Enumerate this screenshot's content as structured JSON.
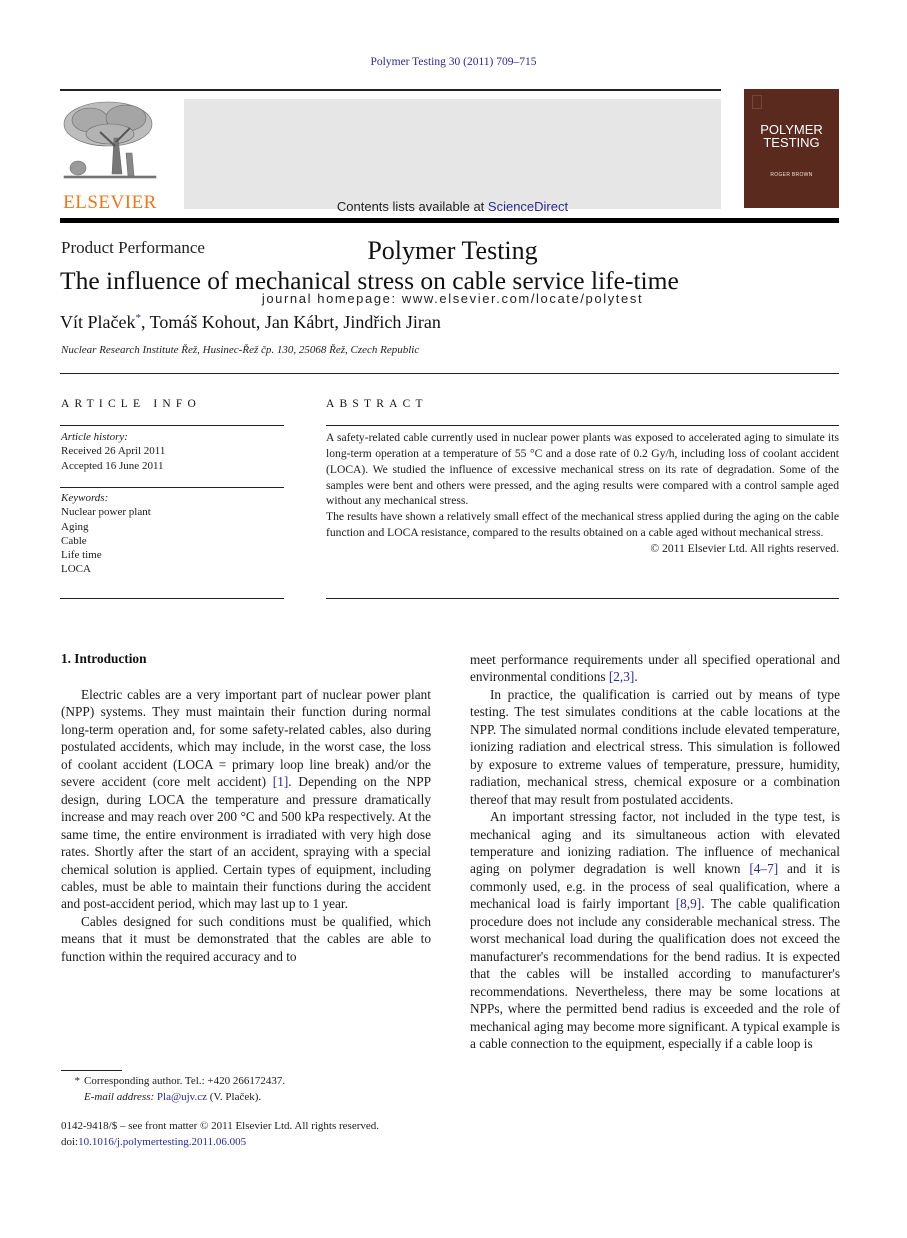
{
  "citation": "Polymer Testing 30 (2011) 709–715",
  "header": {
    "publisher_logo_text": "ELSEVIER",
    "contents_prefix": "Contents lists available at ",
    "contents_link": "ScienceDirect",
    "journal_title": "Polymer Testing",
    "homepage_line": "journal homepage: www.elsevier.com/locate/polytest",
    "cover": {
      "title_line1": "POLYMER",
      "title_line2": "TESTING",
      "editor": "ROGER BROWN",
      "background_color": "#5a2a1e"
    },
    "logo_color": "#e87722"
  },
  "article": {
    "section": "Product Performance",
    "title": "The influence of mechanical stress on cable service life-time",
    "authors": [
      {
        "name": "Vít Plaček",
        "mark": "*"
      },
      {
        "name": "Tomáš Kohout",
        "mark": ""
      },
      {
        "name": "Jan Kábrt",
        "mark": ""
      },
      {
        "name": "Jindřich Jiran",
        "mark": ""
      }
    ],
    "affiliation": "Nuclear Research Institute Řež, Husinec-Řež čp. 130, 25068 Řež, Czech Republic"
  },
  "article_info": {
    "heading": "ARTICLE INFO",
    "history_label": "Article history:",
    "received": "Received 26 April 2011",
    "accepted": "Accepted 16 June 2011",
    "keywords_label": "Keywords:",
    "keywords": [
      "Nuclear power plant",
      "Aging",
      "Cable",
      "Life time",
      "LOCA"
    ]
  },
  "abstract": {
    "heading": "ABSTRACT",
    "paragraph1": "A safety-related cable currently used in nuclear power plants was exposed to accelerated aging to simulate its long-term operation at a temperature of 55 °C and a dose rate of 0.2 Gy/h, including loss of coolant accident (LOCA). We studied the influence of excessive mechanical stress on its rate of degradation. Some of the samples were bent and others were pressed, and the aging results were compared with a control sample aged without any mechanical stress.",
    "paragraph2": "The results have shown a relatively small effect of the mechanical stress applied during the aging on the cable function and LOCA resistance, compared to the results obtained on a cable aged without mechanical stress.",
    "copyright": "© 2011 Elsevier Ltd. All rights reserved."
  },
  "introduction": {
    "heading": "1.  Introduction",
    "left": {
      "p1_a": "Electric cables are a very important part of nuclear power plant (NPP) systems. They must maintain their function during normal long-term operation and, for some safety-related cables, also during postulated accidents, which may include, in the worst case, the loss of coolant accident (LOCA = primary loop line break) and/or the severe accident (core melt accident) ",
      "p1_ref": "[1]",
      "p1_b": ". Depending on the NPP design, during LOCA the temperature and pressure dramatically increase and may reach over 200 °C and 500 kPa respectively. At the same time, the entire environment is irradiated with very high dose rates. Shortly after the start of an accident, spraying with a special chemical solution is applied. Certain types of equipment, including cables, must be able to maintain their functions during the accident and post-accident period, which may last up to 1 year.",
      "p2": "Cables designed for such conditions must be qualified, which means that it must be demonstrated that the cables are able to function within the required accuracy and to"
    },
    "right": {
      "p1_a": "meet performance requirements under all specified operational and environmental conditions ",
      "p1_ref": "[2,3]",
      "p1_b": ".",
      "p2": "In practice, the qualification is carried out by means of type testing. The test simulates conditions at the cable locations at the NPP. The simulated normal conditions include elevated temperature, ionizing radiation and electrical stress. This simulation is followed by exposure to extreme values of temperature, pressure, humidity, radiation, mechanical stress, chemical exposure or a combination thereof that may result from postulated accidents.",
      "p3_a": "An important stressing factor, not included in the type test, is mechanical aging and its simultaneous action with elevated temperature and ionizing radiation. The influence of mechanical aging on polymer degradation is well known ",
      "p3_ref1": "[4–7]",
      "p3_b": " and it is commonly used, e.g. in the process of seal qualification, where a mechanical load is fairly important ",
      "p3_ref2": "[8,9]",
      "p3_c": ". The cable qualification procedure does not include any considerable mechanical stress. The worst mechanical load during the qualification does not exceed the manufacturer's recommendations for the bend radius. It is expected that the cables will be installed according to manufacturer's recommendations. Nevertheless, there may be some locations at NPPs, where the permitted bend radius is exceeded and the role of mechanical aging may become more significant. A typical example is a cable connection to the equipment, especially if a cable loop is"
    }
  },
  "footnote": {
    "star": "*",
    "corresponding": "Corresponding author. Tel.: +420 266172437.",
    "email_label": "E-mail address:",
    "email": "Pla@ujv.cz",
    "email_suffix": " (V. Plaček).",
    "frontmatter": "0142-9418/$ – see front matter © 2011 Elsevier Ltd. All rights reserved.",
    "doi_prefix": "doi:",
    "doi": "10.1016/j.polymertesting.2011.06.005"
  },
  "link_color": "#2a2a8c"
}
